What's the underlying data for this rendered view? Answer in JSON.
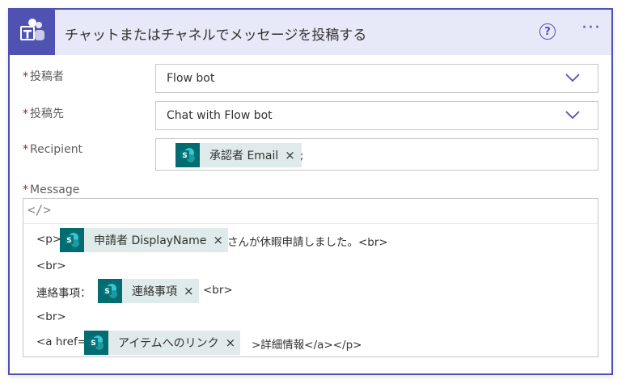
{
  "header": {
    "title": "チャットまたはチャネルでメッセージを投稿する",
    "help_glyph": "?",
    "more_glyph": "···"
  },
  "fields": {
    "poster": {
      "label": "投稿者",
      "value": "Flow bot"
    },
    "post_in": {
      "label": "投稿先",
      "value": "Chat with Flow bot"
    },
    "recipient": {
      "label": "Recipient",
      "token": "承認者 Email",
      "separator": ";"
    },
    "message": {
      "label": "Message"
    }
  },
  "required_mark": "*",
  "token_remove": "×",
  "editor": {
    "code_toggle": "</>",
    "line1_prefix": "<p>",
    "line1_token": "申請者 DisplayName",
    "line1_suffix": "さんが休暇申請しました。<br>",
    "line2": "<br>",
    "line3_prefix": "連絡事項：",
    "line3_token": "連絡事項",
    "line3_suffix": "<br>",
    "line4": "<br>",
    "line5_prefix": "<a href=",
    "line5_token": "アイテムへのリンク",
    "line5_suffix": ">詳細情報</a></p>"
  },
  "colors": {
    "teams_purple": "#4f52b2",
    "header_bg": "#e8e9f8",
    "token_bg": "#dfeaea",
    "sharepoint_teal": "#036c70",
    "required_red": "#a4262c"
  },
  "icons": {
    "app": "teams-icon",
    "token": "sharepoint-icon"
  }
}
